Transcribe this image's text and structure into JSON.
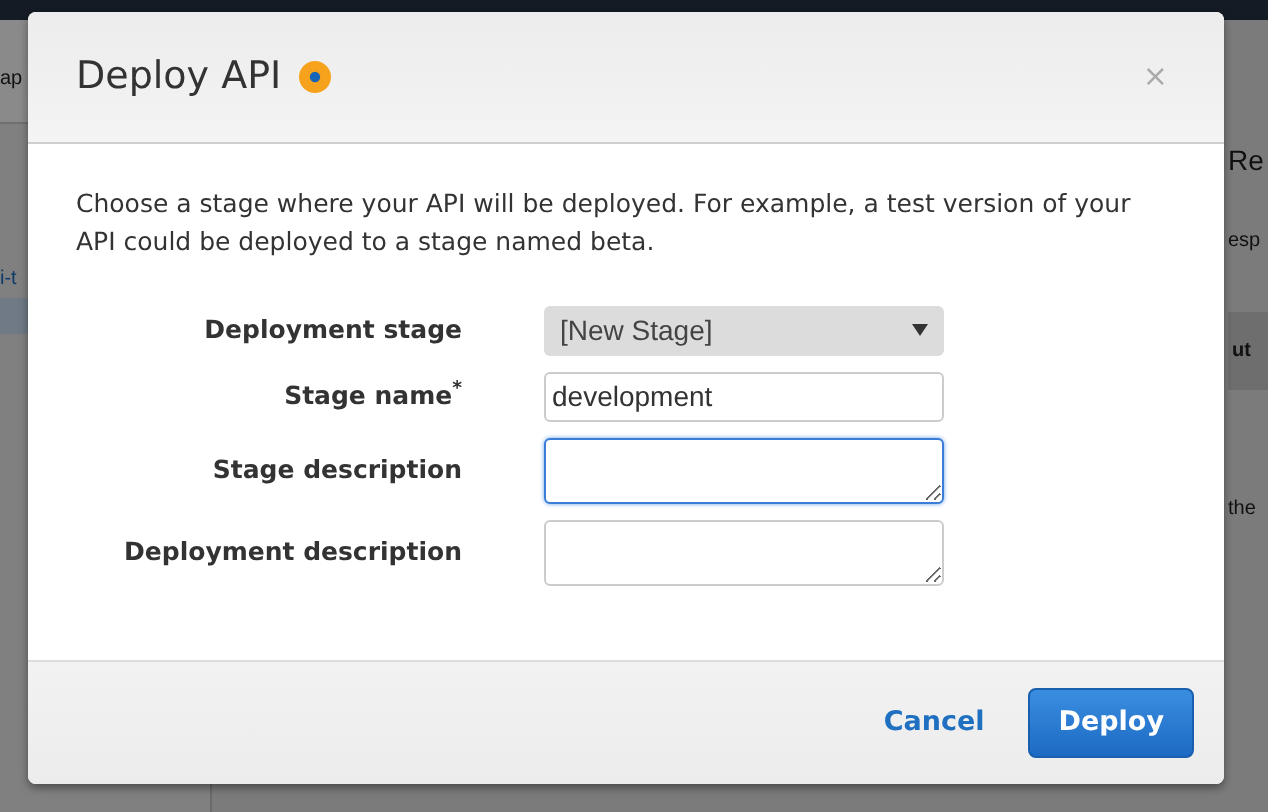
{
  "background": {
    "top_fragment": "ap",
    "sidebar_link": "i-t",
    "heading": "Re",
    "text_1": "esp",
    "column_header": "ut",
    "text_2": "the"
  },
  "dialog": {
    "title": "Deploy API",
    "close": "×",
    "description": "Choose a stage where your API will be deployed. For example, a test version of your API could be deployed to a stage named beta.",
    "fields": [
      {
        "kind": "select",
        "label": "Deployment stage",
        "value": "[New Stage]"
      },
      {
        "kind": "text",
        "label": "Stage name$^{*}$",
        "value": "development"
      },
      {
        "kind": "textarea",
        "label": "Stage description",
        "focused": true
      },
      {
        "kind": "textarea",
        "label": "Deployment description",
        "focused": false
      }
    ],
    "buttons": [
      {
        "kind": "link",
        "label": "Cancel"
      },
      {
        "kind": "primary",
        "label": "Deploy"
      }
    ]
  }
}
